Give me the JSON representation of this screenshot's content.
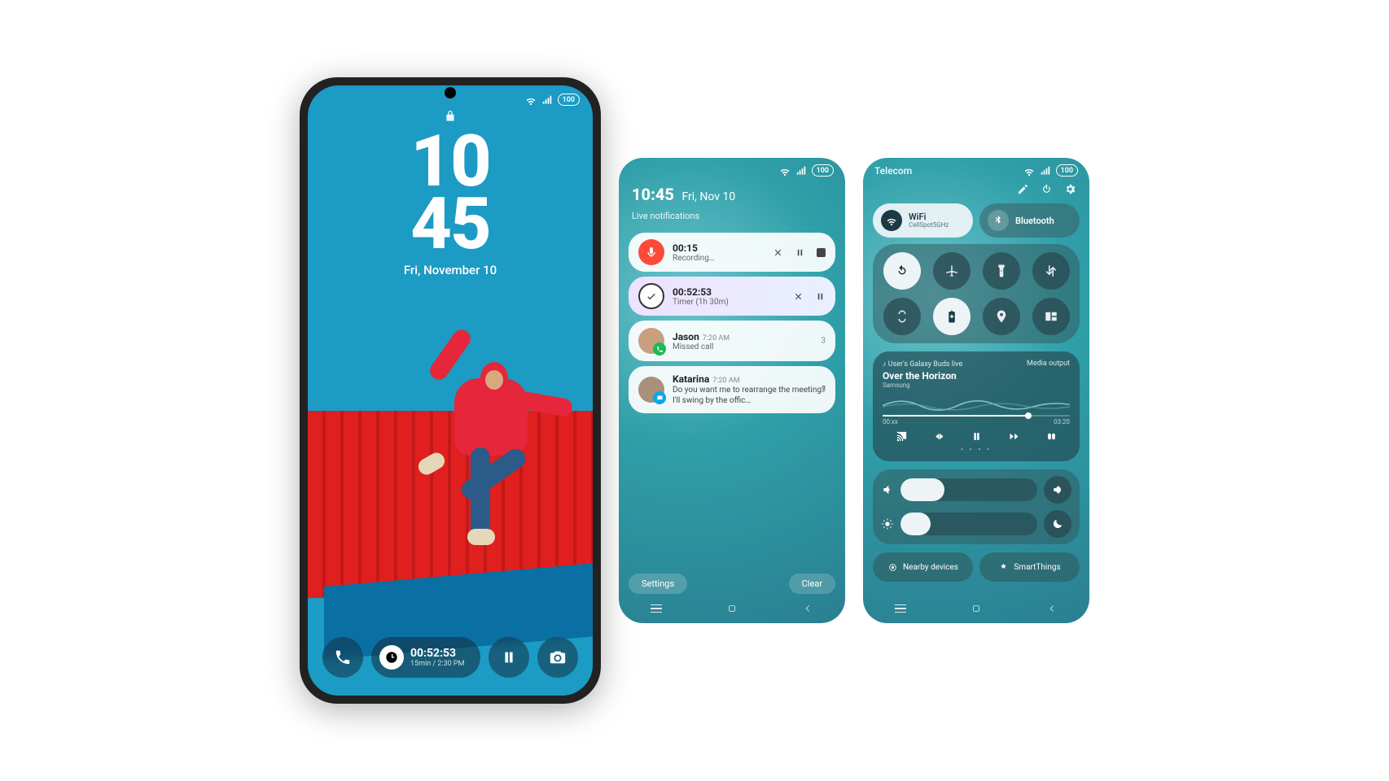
{
  "colors": {
    "accent_teal": "#2a9aa8",
    "record_red": "#ff4a3a",
    "phone_green": "#1db954",
    "msg_blue": "#0ea5e9"
  },
  "status": {
    "battery": "100"
  },
  "lockscreen": {
    "time_h": "10",
    "time_m": "45",
    "date": "Fri, November 10",
    "timer_value": "00:52:53",
    "timer_sub": "15min / 2:30 PM"
  },
  "notif_panel": {
    "time": "10:45",
    "date": "Fri, Nov 10",
    "header": "Live notifications",
    "recording": {
      "time": "00:15",
      "label": "Recording…"
    },
    "timer": {
      "time": "00:52:53",
      "label": "Timer (1h 30m)"
    },
    "call": {
      "name": "Jason",
      "time": "7:20 AM",
      "sub": "Missed call",
      "count": "3"
    },
    "message": {
      "name": "Katarina",
      "time": "7:20 AM",
      "body": "Do you want me to rearrange the meeting? I'll swing by the offic…",
      "count": "5"
    },
    "settings_btn": "Settings",
    "clear_btn": "Clear"
  },
  "qs_panel": {
    "carrier": "Telecom",
    "wifi": {
      "label": "WiFi",
      "sub": "CellSpot5GHz"
    },
    "bt": {
      "label": "Bluetooth"
    },
    "media": {
      "device": "User's Galaxy Buds live",
      "output_label": "Media output",
      "title": "Over the Horizon",
      "artist": "Samsung",
      "elapsed": "00:xx",
      "total": "03:20"
    },
    "nearby": "Nearby devices",
    "smartthings": "SmartThings"
  }
}
